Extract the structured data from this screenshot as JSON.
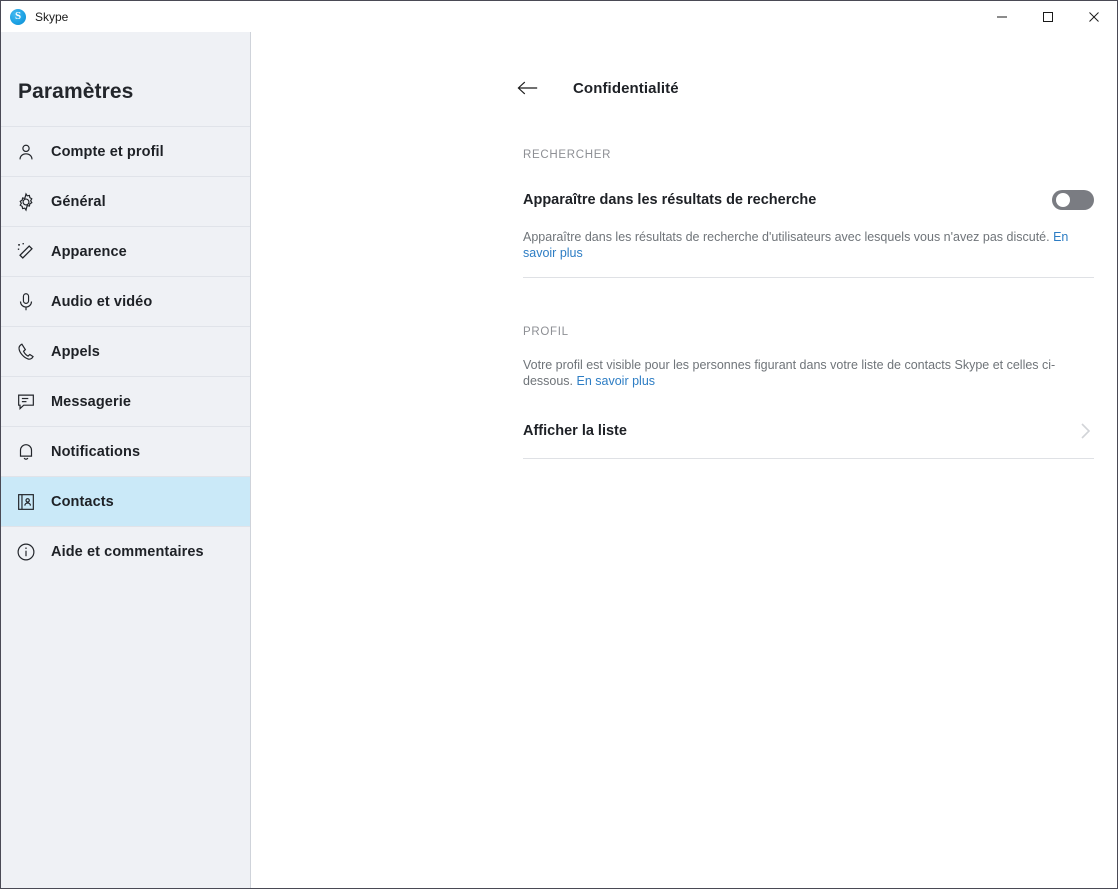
{
  "window": {
    "app_title": "Skype",
    "logo_letter": "S",
    "controls": [
      {
        "name": "minimize",
        "label": "Minimize"
      },
      {
        "name": "maximize",
        "label": "Maximize"
      },
      {
        "name": "close",
        "label": "Close"
      }
    ]
  },
  "sidebar": {
    "heading": "Paramètres",
    "items": [
      {
        "label": "Compte et profil",
        "icon": "person-icon",
        "active": false
      },
      {
        "label": "Général",
        "icon": "gear-icon",
        "active": false
      },
      {
        "label": "Apparence",
        "icon": "magic-wand-icon",
        "active": false
      },
      {
        "label": "Audio et vidéo",
        "icon": "microphone-icon",
        "active": false
      },
      {
        "label": "Appels",
        "icon": "phone-icon",
        "active": false
      },
      {
        "label": "Messagerie",
        "icon": "message-icon",
        "active": false
      },
      {
        "label": "Notifications",
        "icon": "bell-icon",
        "active": false
      },
      {
        "label": "Contacts",
        "icon": "contact-book-icon",
        "active": true
      },
      {
        "label": "Aide et commentaires",
        "icon": "info-icon",
        "active": false
      }
    ]
  },
  "main": {
    "back_label": "Retour",
    "page_title": "Confidentialité",
    "search_section": {
      "label": "RECHERCHER",
      "setting_title": "Apparaître dans les résultats de recherche",
      "toggle_state": "off",
      "help_text": "Apparaître dans les résultats de recherche d'utilisateurs avec lesquels vous n'avez pas discuté. ",
      "help_link": "En savoir plus"
    },
    "profile_section": {
      "label": "PROFIL",
      "description": "Votre profil est visible pour les personnes figurant dans votre liste de contacts Skype et celles ci-dessous. ",
      "description_link": "En savoir plus",
      "list_row_label": "Afficher la liste"
    }
  },
  "colors": {
    "sidebar_bg": "#eff1f5",
    "active_item": "#cae9f8",
    "link": "#2d7dc4",
    "toggle_off": "#7a7c82",
    "skype_blue": "#1ea2e4"
  }
}
